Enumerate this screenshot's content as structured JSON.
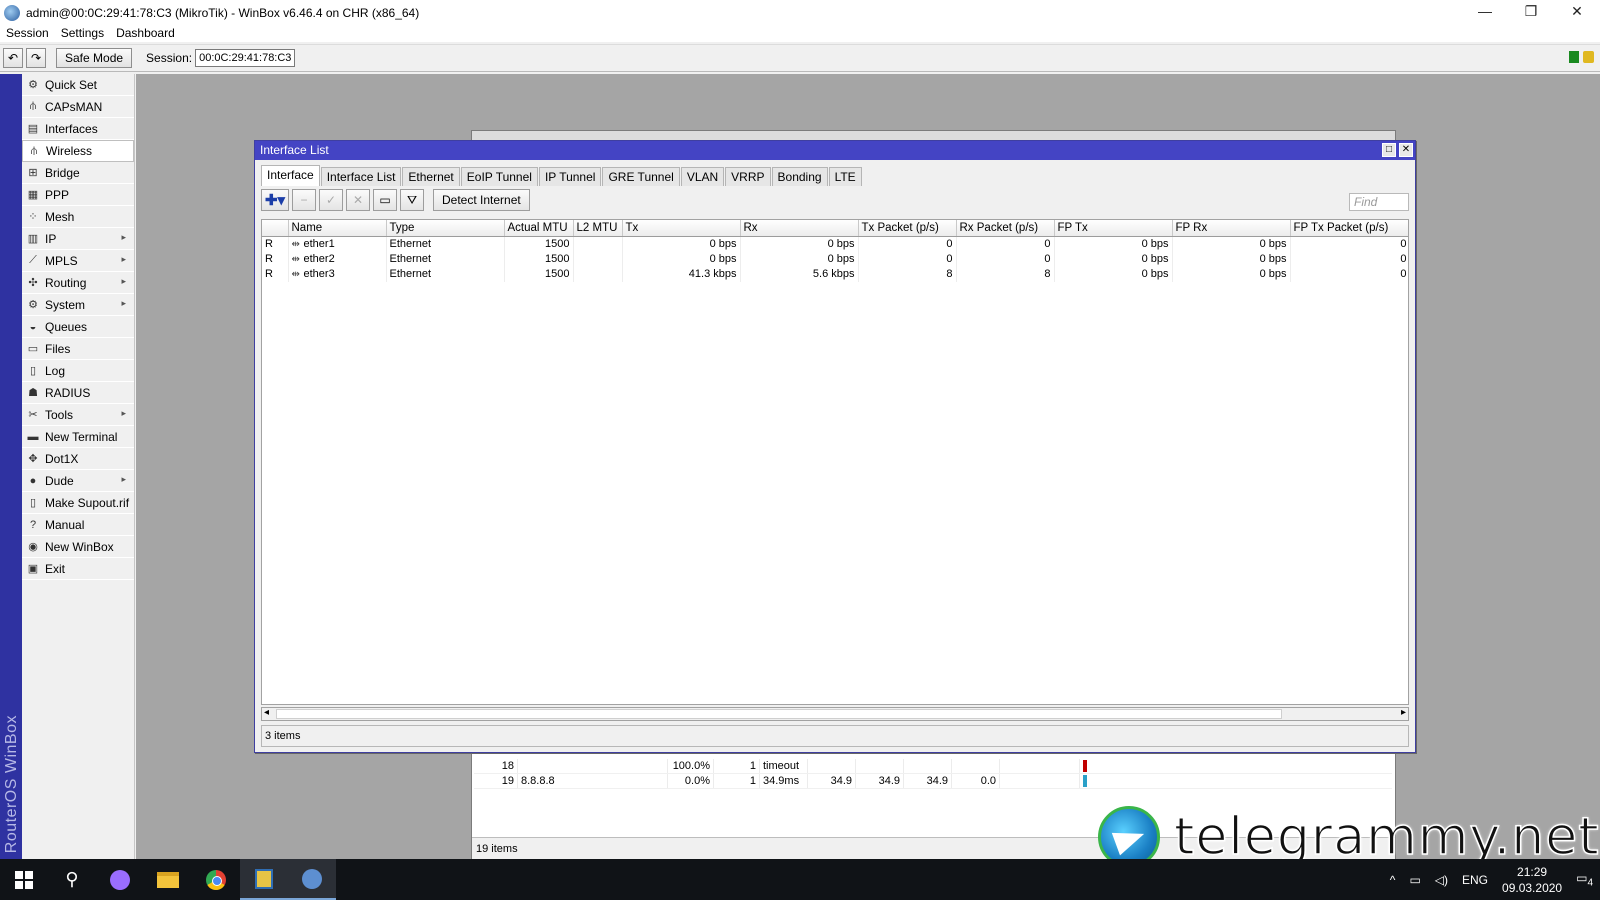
{
  "window": {
    "title": "admin@00:0C:29:41:78:C3 (MikroTik) - WinBox v6.46.4 on CHR (x86_64)",
    "controls": [
      "—",
      "❐",
      "✕"
    ]
  },
  "menu": [
    "Session",
    "Settings",
    "Dashboard"
  ],
  "toolbar": {
    "undo": "↶",
    "redo": "↷",
    "safe_mode": "Safe Mode",
    "session_label": "Session:",
    "session_value": "00:0C:29:41:78:C3"
  },
  "brand": "RouterOS WinBox",
  "sidebar": {
    "items": [
      {
        "label": "Quick Set",
        "icon": "quick-set-icon",
        "glyph": "⚙",
        "submenu": false
      },
      {
        "label": "CAPsMAN",
        "icon": "capsman-icon",
        "glyph": "⫛",
        "submenu": false
      },
      {
        "label": "Interfaces",
        "icon": "interfaces-icon",
        "glyph": "▤",
        "submenu": false
      },
      {
        "label": "Wireless",
        "icon": "wireless-icon",
        "glyph": "⫛",
        "submenu": false
      },
      {
        "label": "Bridge",
        "icon": "bridge-icon",
        "glyph": "⊞",
        "submenu": false
      },
      {
        "label": "PPP",
        "icon": "ppp-icon",
        "glyph": "▦",
        "submenu": false
      },
      {
        "label": "Mesh",
        "icon": "mesh-icon",
        "glyph": "⁘",
        "submenu": false
      },
      {
        "label": "IP",
        "icon": "ip-icon",
        "glyph": "▥",
        "submenu": true
      },
      {
        "label": "MPLS",
        "icon": "mpls-icon",
        "glyph": "⟋",
        "submenu": true
      },
      {
        "label": "Routing",
        "icon": "routing-icon",
        "glyph": "✣",
        "submenu": true
      },
      {
        "label": "System",
        "icon": "system-icon",
        "glyph": "⚙",
        "submenu": true
      },
      {
        "label": "Queues",
        "icon": "queues-icon",
        "glyph": "◒",
        "submenu": false
      },
      {
        "label": "Files",
        "icon": "files-icon",
        "glyph": "▭",
        "submenu": false
      },
      {
        "label": "Log",
        "icon": "log-icon",
        "glyph": "▯",
        "submenu": false
      },
      {
        "label": "RADIUS",
        "icon": "radius-icon",
        "glyph": "☗",
        "submenu": false
      },
      {
        "label": "Tools",
        "icon": "tools-icon",
        "glyph": "✂",
        "submenu": true
      },
      {
        "label": "New Terminal",
        "icon": "terminal-icon",
        "glyph": "▬",
        "submenu": false
      },
      {
        "label": "Dot1X",
        "icon": "dot1x-icon",
        "glyph": "✥",
        "submenu": false
      },
      {
        "label": "Dude",
        "icon": "dude-icon",
        "glyph": "●",
        "submenu": true
      },
      {
        "label": "Make Supout.rif",
        "icon": "supout-icon",
        "glyph": "▯",
        "submenu": false
      },
      {
        "label": "Manual",
        "icon": "manual-icon",
        "glyph": "?",
        "submenu": false
      },
      {
        "label": "New WinBox",
        "icon": "new-winbox-icon",
        "glyph": "◉",
        "submenu": false
      },
      {
        "label": "Exit",
        "icon": "exit-icon",
        "glyph": "▣",
        "submenu": false
      }
    ]
  },
  "background_window": {
    "rows": [
      {
        "seq": "18",
        "host": "",
        "loss": "100.0%",
        "sent": "1",
        "status": "timeout",
        "last": "",
        "avg": "",
        "best": "",
        "worst": "",
        "stddev": "",
        "marker_color": "#c00000"
      },
      {
        "seq": "19",
        "host": "8.8.8.8",
        "loss": "0.0%",
        "sent": "1",
        "status": "34.9ms",
        "last": "34.9",
        "avg": "34.9",
        "best": "34.9",
        "worst": "0.0",
        "stddev": "",
        "marker_color": "#2aa0c8"
      }
    ],
    "status": "19 items"
  },
  "interface_list": {
    "title": "Interface List",
    "tabs": [
      "Interface",
      "Interface List",
      "Ethernet",
      "EoIP Tunnel",
      "IP Tunnel",
      "GRE Tunnel",
      "VLAN",
      "VRRP",
      "Bonding",
      "LTE"
    ],
    "toolbar": {
      "detect": "Detect Internet",
      "find_placeholder": "Find"
    },
    "columns": [
      "",
      "Name",
      "Type",
      "Actual MTU",
      "L2 MTU",
      "Tx",
      "Rx",
      "Tx Packet (p/s)",
      "Rx Packet (p/s)",
      "FP Tx",
      "FP Rx",
      "FP Tx Packet (p/s)"
    ],
    "rows": [
      {
        "flag": "R",
        "name": "ether1",
        "type": "Ethernet",
        "mtu": "1500",
        "l2mtu": "",
        "tx": "0 bps",
        "rx": "0 bps",
        "txp": "0",
        "rxp": "0",
        "fptx": "0 bps",
        "fprx": "0 bps",
        "fptxp": "0"
      },
      {
        "flag": "R",
        "name": "ether2",
        "type": "Ethernet",
        "mtu": "1500",
        "l2mtu": "",
        "tx": "0 bps",
        "rx": "0 bps",
        "txp": "0",
        "rxp": "0",
        "fptx": "0 bps",
        "fprx": "0 bps",
        "fptxp": "0"
      },
      {
        "flag": "R",
        "name": "ether3",
        "type": "Ethernet",
        "mtu": "1500",
        "l2mtu": "",
        "tx": "41.3 kbps",
        "rx": "5.6 kbps",
        "txp": "8",
        "rxp": "8",
        "fptx": "0 bps",
        "fprx": "0 bps",
        "fptxp": "0"
      }
    ],
    "status": "3 items"
  },
  "watermark": "telegrammy.net",
  "taskbar": {
    "lang": "ENG",
    "time": "21:29",
    "date": "09.03.2020",
    "notifications": "4"
  }
}
